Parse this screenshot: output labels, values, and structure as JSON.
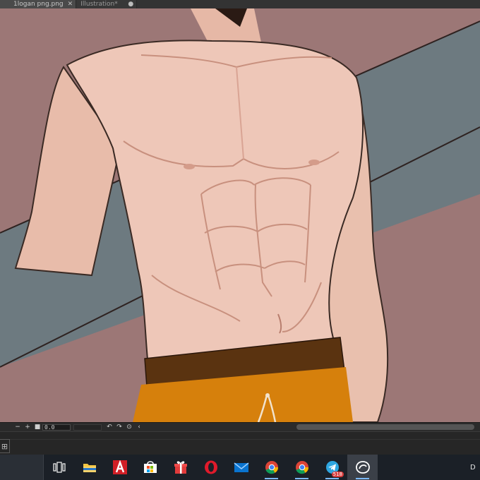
{
  "window": {
    "tabs": [
      {
        "label": "1logan png.png",
        "close": "✕"
      },
      {
        "label": "Illustration*",
        "dot": "●"
      }
    ]
  },
  "canvas": {
    "artwork": "muscular torso illustration",
    "colors": {
      "background": "#9c7776",
      "board": "#6d7a80",
      "skin": "#eec7b8",
      "shorts": "#d6800c",
      "waistband": "#5a3310",
      "outline": "#3a2a24"
    }
  },
  "status_bar": {
    "zoom_out": "−",
    "zoom_in": "+",
    "fit": "■",
    "zoom_value": "0.0",
    "rotate_left": "↶",
    "rotate_right": "↷",
    "reset": "⊙",
    "flip": "‹"
  },
  "panel": {
    "navigator_icon": "⊞"
  },
  "taskbar": {
    "tray_text": "D",
    "apps": [
      {
        "name": "task-view",
        "icon": "task-view-icon"
      },
      {
        "name": "file-explorer",
        "icon": "folder-icon"
      },
      {
        "name": "autocad",
        "icon": "autocad-icon"
      },
      {
        "name": "store",
        "icon": "store-icon"
      },
      {
        "name": "gift",
        "icon": "gift-icon"
      },
      {
        "name": "opera",
        "icon": "opera-icon"
      },
      {
        "name": "mail",
        "icon": "mail-icon"
      },
      {
        "name": "chrome",
        "icon": "chrome-icon"
      },
      {
        "name": "chrome-2",
        "icon": "chrome-icon"
      },
      {
        "name": "telegram",
        "icon": "telegram-icon",
        "badge": "518"
      },
      {
        "name": "clip-studio",
        "icon": "clip-studio-icon"
      }
    ]
  }
}
